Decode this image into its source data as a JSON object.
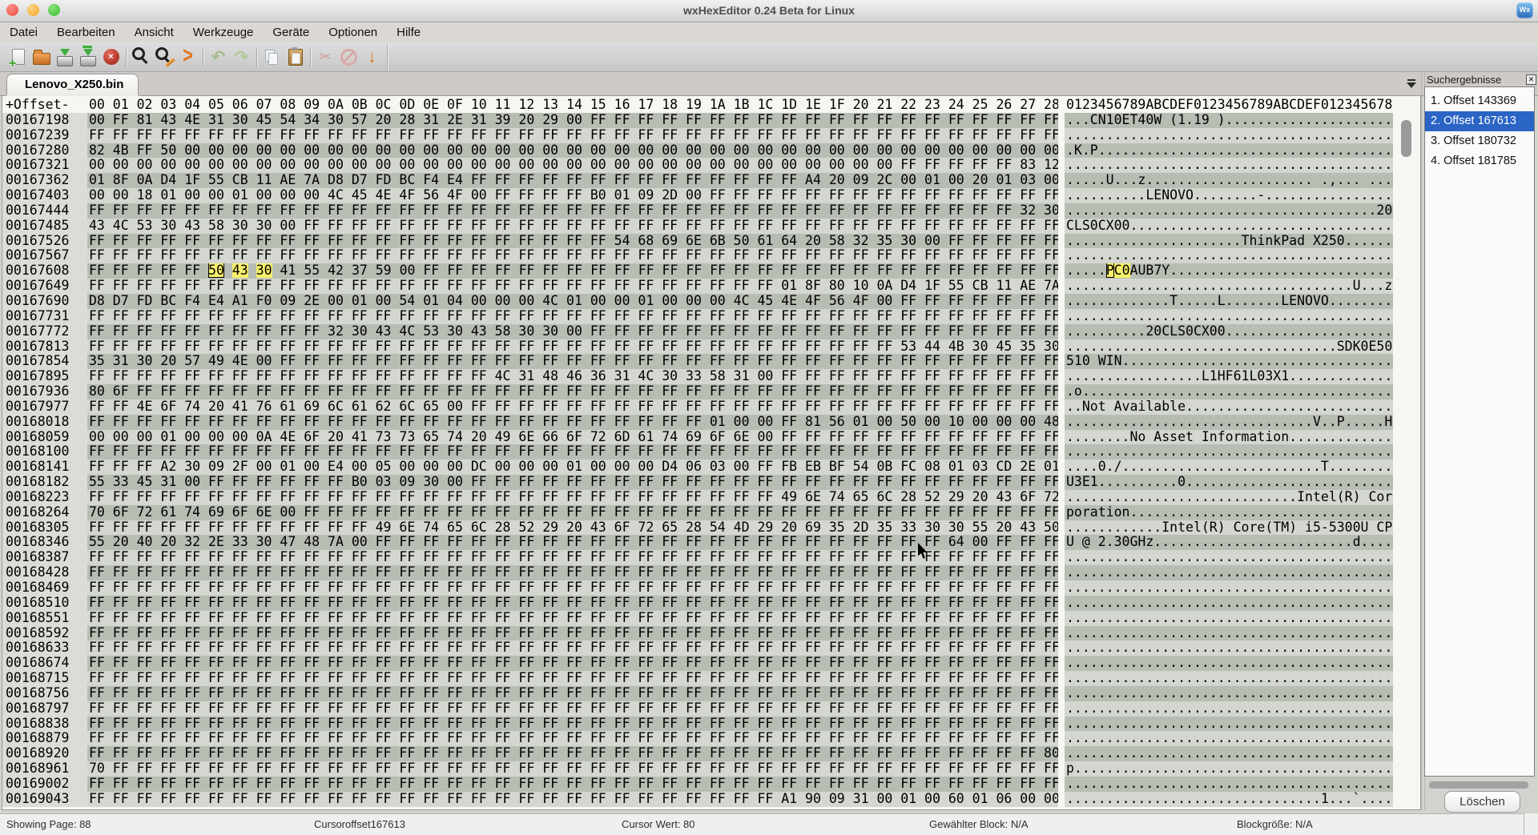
{
  "window": {
    "title": "wxHexEditor 0.24 Beta for Linux",
    "app_icon_label": "Wx"
  },
  "menubar": {
    "items": [
      "Datei",
      "Bearbeiten",
      "Ansicht",
      "Werkzeuge",
      "Geräte",
      "Optionen",
      "Hilfe"
    ]
  },
  "toolbar": {
    "buttons": [
      "new-file",
      "open-file",
      "save",
      "save-as",
      "close-file",
      "find",
      "find-replace",
      "goto-offset",
      "undo",
      "redo",
      "copy",
      "paste",
      "cut",
      "abort",
      "jump-down"
    ],
    "groups": [
      5,
      3,
      2,
      2,
      3
    ]
  },
  "tabs": {
    "active": "Lenovo_X250.bin"
  },
  "hex_view": {
    "offset_header": "+Offset-",
    "byte_header": "00 01 02 03 04 05 06 07 08 09 0A 0B 0C 0D 0E 0F 10 11 12 13 14 15 16 17 18 19 1A 1B 1C 1D 1E 1F 20 21 22 23 24 25 26 27 28",
    "ascii_header": "0123456789ABCDEF0123456789ABCDEF012345678",
    "selection": {
      "row_offset": "00167608",
      "cursor_index": 5,
      "selected_indices": [
        6,
        7
      ]
    },
    "colors": {
      "stripe_dark": "#b8bdb3",
      "stripe_light": "#d3d7cf",
      "highlight": "#f7f06a",
      "selected_result": "#2a64c4"
    },
    "rows": [
      {
        "offset": "00167198",
        "bytes": "00 FF 81 43 4E 31 30 45 54 34 30 57 20 28 31 2E 31 39 20 29 00 FF FF FF FF FF FF FF FF FF FF FF FF FF FF FF FF FF FF FF FF"
      },
      {
        "offset": "00167239",
        "bytes": "FF FF FF FF FF FF FF FF FF FF FF FF FF FF FF FF FF FF FF FF FF FF FF FF FF FF FF FF FF FF FF FF FF FF FF FF FF FF FF FF FF"
      },
      {
        "offset": "00167280",
        "bytes": "82 4B FF 50 00 00 00 00 00 00 00 00 00 00 00 00 00 00 00 00 00 00 00 00 00 00 00 00 00 00 00 00 00 00 00 00 00 00 00 00 00"
      },
      {
        "offset": "00167321",
        "bytes": "00 00 00 00 00 00 00 00 00 00 00 00 00 00 00 00 00 00 00 00 00 00 00 00 00 00 00 00 00 00 00 00 00 00 FF FF FF FF FF 83 12"
      },
      {
        "offset": "00167362",
        "bytes": "01 8F 0A D4 1F 55 CB 11 AE 7A D8 D7 FD BC F4 E4 FF FF FF FF FF FF FF FF FF FF FF FF FF FF A4 20 09 2C 00 01 00 20 01 03 00"
      },
      {
        "offset": "00167403",
        "bytes": "00 00 18 01 00 00 01 00 00 00 4C 45 4E 4F 56 4F 00 FF FF FF FF B0 01 09 2D 00 FF FF FF FF FF FF FF FF FF FF FF FF FF FF FF"
      },
      {
        "offset": "00167444",
        "bytes": "FF FF FF FF FF FF FF FF FF FF FF FF FF FF FF FF FF FF FF FF FF FF FF FF FF FF FF FF FF FF FF FF FF FF FF FF FF FF FF 32 30"
      },
      {
        "offset": "00167485",
        "bytes": "43 4C 53 30 43 58 30 30 00 FF FF FF FF FF FF FF FF FF FF FF FF FF FF FF FF FF FF FF FF FF FF FF FF FF FF FF FF FF FF FF FF"
      },
      {
        "offset": "00167526",
        "bytes": "FF FF FF FF FF FF FF FF FF FF FF FF FF FF FF FF FF FF FF FF FF FF 54 68 69 6E 6B 50 61 64 20 58 32 35 30 00 FF FF FF FF FF"
      },
      {
        "offset": "00167567",
        "bytes": "FF FF FF FF FF FF FF FF FF FF FF FF FF FF FF FF FF FF FF FF FF FF FF FF FF FF FF FF FF FF FF FF FF FF FF FF FF FF FF FF FF"
      },
      {
        "offset": "00167608",
        "bytes": "FF FF FF FF FF 50 43 30 41 55 42 37 59 00 FF FF FF FF FF FF FF FF FF FF FF FF FF FF FF FF FF FF FF FF FF FF FF FF FF FF FF"
      },
      {
        "offset": "00167649",
        "bytes": "FF FF FF FF FF FF FF FF FF FF FF FF FF FF FF FF FF FF FF FF FF FF FF FF FF FF FF FF FF 01 8F 80 10 0A D4 1F 55 CB 11 AE 7A"
      },
      {
        "offset": "00167690",
        "bytes": "D8 D7 FD BC F4 E4 A1 F0 09 2E 00 01 00 54 01 04 00 00 00 4C 01 00 00 01 00 00 00 4C 45 4E 4F 56 4F 00 FF FF FF FF FF FF FF"
      },
      {
        "offset": "00167731",
        "bytes": "FF FF FF FF FF FF FF FF FF FF FF FF FF FF FF FF FF FF FF FF FF FF FF FF FF FF FF FF FF FF FF FF FF FF FF FF FF FF FF FF FF"
      },
      {
        "offset": "00167772",
        "bytes": "FF FF FF FF FF FF FF FF FF FF 32 30 43 4C 53 30 43 58 30 30 00 FF FF FF FF FF FF FF FF FF FF FF FF FF FF FF FF FF FF FF FF"
      },
      {
        "offset": "00167813",
        "bytes": "FF FF FF FF FF FF FF FF FF FF FF FF FF FF FF FF FF FF FF FF FF FF FF FF FF FF FF FF FF FF FF FF FF FF 53 44 4B 30 45 35 30"
      },
      {
        "offset": "00167854",
        "bytes": "35 31 30 20 57 49 4E 00 FF FF FF FF FF FF FF FF FF FF FF FF FF FF FF FF FF FF FF FF FF FF FF FF FF FF FF FF FF FF FF FF FF"
      },
      {
        "offset": "00167895",
        "bytes": "FF FF FF FF FF FF FF FF FF FF FF FF FF FF FF FF FF 4C 31 48 46 36 31 4C 30 33 58 31 00 FF FF FF FF FF FF FF FF FF FF FF FF"
      },
      {
        "offset": "00167936",
        "bytes": "80 6F FF FF FF FF FF FF FF FF FF FF FF FF FF FF FF FF FF FF FF FF FF FF FF FF FF FF FF FF FF FF FF FF FF FF FF FF FF FF FF"
      },
      {
        "offset": "00167977",
        "bytes": "FF FF 4E 6F 74 20 41 76 61 69 6C 61 62 6C 65 00 FF FF FF FF FF FF FF FF FF FF FF FF FF FF FF FF FF FF FF FF FF FF FF FF FF"
      },
      {
        "offset": "00168018",
        "bytes": "FF FF FF FF FF FF FF FF FF FF FF FF FF FF FF FF FF FF FF FF FF FF FF FF FF FF 01 00 00 FF 81 56 01 00 50 00 10 00 00 00 48"
      },
      {
        "offset": "00168059",
        "bytes": "00 00 00 01 00 00 00 0A 4E 6F 20 41 73 73 65 74 20 49 6E 66 6F 72 6D 61 74 69 6F 6E 00 FF FF FF FF FF FF FF FF FF FF FF FF"
      },
      {
        "offset": "00168100",
        "bytes": "FF FF FF FF FF FF FF FF FF FF FF FF FF FF FF FF FF FF FF FF FF FF FF FF FF FF FF FF FF FF FF FF FF FF FF FF FF FF FF FF FF"
      },
      {
        "offset": "00168141",
        "bytes": "FF FF FF A2 30 09 2F 00 01 00 E4 00 05 00 00 00 DC 00 00 00 01 00 00 00 D4 06 03 00 FF FB EB BF 54 0B FC 08 01 03 CD 2E 01"
      },
      {
        "offset": "00168182",
        "bytes": "55 33 45 31 00 FF FF FF FF FF FF B0 03 09 30 00 FF FF FF FF FF FF FF FF FF FF FF FF FF FF FF FF FF FF FF FF FF FF FF FF FF"
      },
      {
        "offset": "00168223",
        "bytes": "FF FF FF FF FF FF FF FF FF FF FF FF FF FF FF FF FF FF FF FF FF FF FF FF FF FF FF FF FF 49 6E 74 65 6C 28 52 29 20 43 6F 72"
      },
      {
        "offset": "00168264",
        "bytes": "70 6F 72 61 74 69 6F 6E 00 FF FF FF FF FF FF FF FF FF FF FF FF FF FF FF FF FF FF FF FF FF FF FF FF FF FF FF FF FF FF FF FF"
      },
      {
        "offset": "00168305",
        "bytes": "FF FF FF FF FF FF FF FF FF FF FF FF 49 6E 74 65 6C 28 52 29 20 43 6F 72 65 28 54 4D 29 20 69 35 2D 35 33 30 30 55 20 43 50"
      },
      {
        "offset": "00168346",
        "bytes": "55 20 40 20 32 2E 33 30 47 48 7A 00 FF FF FF FF FF FF FF FF FF FF FF FF FF FF FF FF FF FF FF FF FF FF FF FF 64 00 FF FF FF"
      },
      {
        "offset": "00168387",
        "bytes": "FF FF FF FF FF FF FF FF FF FF FF FF FF FF FF FF FF FF FF FF FF FF FF FF FF FF FF FF FF FF FF FF FF FF FF FF FF FF FF FF FF"
      },
      {
        "offset": "00168428",
        "bytes": "FF FF FF FF FF FF FF FF FF FF FF FF FF FF FF FF FF FF FF FF FF FF FF FF FF FF FF FF FF FF FF FF FF FF FF FF FF FF FF FF FF"
      },
      {
        "offset": "00168469",
        "bytes": "FF FF FF FF FF FF FF FF FF FF FF FF FF FF FF FF FF FF FF FF FF FF FF FF FF FF FF FF FF FF FF FF FF FF FF FF FF FF FF FF FF"
      },
      {
        "offset": "00168510",
        "bytes": "FF FF FF FF FF FF FF FF FF FF FF FF FF FF FF FF FF FF FF FF FF FF FF FF FF FF FF FF FF FF FF FF FF FF FF FF FF FF FF FF FF"
      },
      {
        "offset": "00168551",
        "bytes": "FF FF FF FF FF FF FF FF FF FF FF FF FF FF FF FF FF FF FF FF FF FF FF FF FF FF FF FF FF FF FF FF FF FF FF FF FF FF FF FF FF"
      },
      {
        "offset": "00168592",
        "bytes": "FF FF FF FF FF FF FF FF FF FF FF FF FF FF FF FF FF FF FF FF FF FF FF FF FF FF FF FF FF FF FF FF FF FF FF FF FF FF FF FF FF"
      },
      {
        "offset": "00168633",
        "bytes": "FF FF FF FF FF FF FF FF FF FF FF FF FF FF FF FF FF FF FF FF FF FF FF FF FF FF FF FF FF FF FF FF FF FF FF FF FF FF FF FF FF"
      },
      {
        "offset": "00168674",
        "bytes": "FF FF FF FF FF FF FF FF FF FF FF FF FF FF FF FF FF FF FF FF FF FF FF FF FF FF FF FF FF FF FF FF FF FF FF FF FF FF FF FF FF"
      },
      {
        "offset": "00168715",
        "bytes": "FF FF FF FF FF FF FF FF FF FF FF FF FF FF FF FF FF FF FF FF FF FF FF FF FF FF FF FF FF FF FF FF FF FF FF FF FF FF FF FF FF"
      },
      {
        "offset": "00168756",
        "bytes": "FF FF FF FF FF FF FF FF FF FF FF FF FF FF FF FF FF FF FF FF FF FF FF FF FF FF FF FF FF FF FF FF FF FF FF FF FF FF FF FF FF"
      },
      {
        "offset": "00168797",
        "bytes": "FF FF FF FF FF FF FF FF FF FF FF FF FF FF FF FF FF FF FF FF FF FF FF FF FF FF FF FF FF FF FF FF FF FF FF FF FF FF FF FF FF"
      },
      {
        "offset": "00168838",
        "bytes": "FF FF FF FF FF FF FF FF FF FF FF FF FF FF FF FF FF FF FF FF FF FF FF FF FF FF FF FF FF FF FF FF FF FF FF FF FF FF FF FF FF"
      },
      {
        "offset": "00168879",
        "bytes": "FF FF FF FF FF FF FF FF FF FF FF FF FF FF FF FF FF FF FF FF FF FF FF FF FF FF FF FF FF FF FF FF FF FF FF FF FF FF FF FF FF"
      },
      {
        "offset": "00168920",
        "bytes": "FF FF FF FF FF FF FF FF FF FF FF FF FF FF FF FF FF FF FF FF FF FF FF FF FF FF FF FF FF FF FF FF FF FF FF FF FF FF FF FF 80"
      },
      {
        "offset": "00168961",
        "bytes": "70 FF FF FF FF FF FF FF FF FF FF FF FF FF FF FF FF FF FF FF FF FF FF FF FF FF FF FF FF FF FF FF FF FF FF FF FF FF FF FF FF"
      },
      {
        "offset": "00169002",
        "bytes": "FF FF FF FF FF FF FF FF FF FF FF FF FF FF FF FF FF FF FF FF FF FF FF FF FF FF FF FF FF FF FF FF FF FF FF FF FF FF FF FF FF"
      },
      {
        "offset": "00169043",
        "bytes": "FF FF FF FF FF FF FF FF FF FF FF FF FF FF FF FF FF FF FF FF FF FF FF FF FF FF FF FF FF A1 90 09 31 00 01 00 60 01 06 00 00"
      }
    ]
  },
  "search_results": {
    "title": "Suchergebnisse",
    "items": [
      "1. Offset 143369",
      "2. Offset 167613",
      "3. Offset 180732",
      "4. Offset 181785"
    ],
    "selected_index": 1,
    "clear_button": "Löschen"
  },
  "statusbar": {
    "fields": [
      "Showing Page: 88",
      "Cursoroffset167613",
      "Cursor Wert: 80",
      "Gewählter Block: N/A",
      "Blockgröße: N/A"
    ]
  }
}
